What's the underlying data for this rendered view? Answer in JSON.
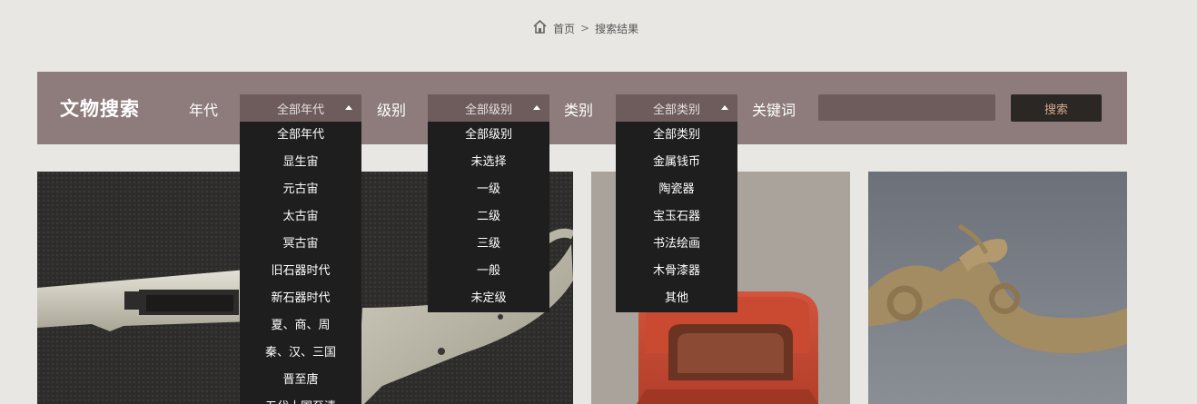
{
  "breadcrumb": {
    "home_icon": "home-icon",
    "home": "首页",
    "separator": ">",
    "current": "搜索结果"
  },
  "search": {
    "title": "文物搜索",
    "era_label": "年代",
    "level_label": "级别",
    "category_label": "类别",
    "keyword_label": "关键词",
    "keyword_value": "",
    "button_label": "搜索",
    "era_selected": "全部年代",
    "level_selected": "全部级别",
    "category_selected": "全部类别",
    "era_options": [
      "全部年代",
      "显生宙",
      "元古宙",
      "太古宙",
      "冥古宙",
      "旧石器时代",
      "新石器时代",
      "夏、商、周",
      "秦、汉、三国",
      "晋至唐",
      "五代十国至清"
    ],
    "level_options": [
      "全部级别",
      "未选择",
      "一级",
      "二级",
      "三级",
      "一般",
      "未定级"
    ],
    "category_options": [
      "全部类别",
      "金属钱币",
      "陶瓷器",
      "宝玉石器",
      "书法绘画",
      "木骨漆器",
      "其他"
    ]
  },
  "colors": {
    "page_bg": "#e8e7e4",
    "bar_bg": "#8e7b7b",
    "select_bg": "#6e5c5c",
    "dropdown_bg": "#1f1e1e",
    "button_bg": "#2a2725",
    "button_text": "#d2a98a"
  }
}
